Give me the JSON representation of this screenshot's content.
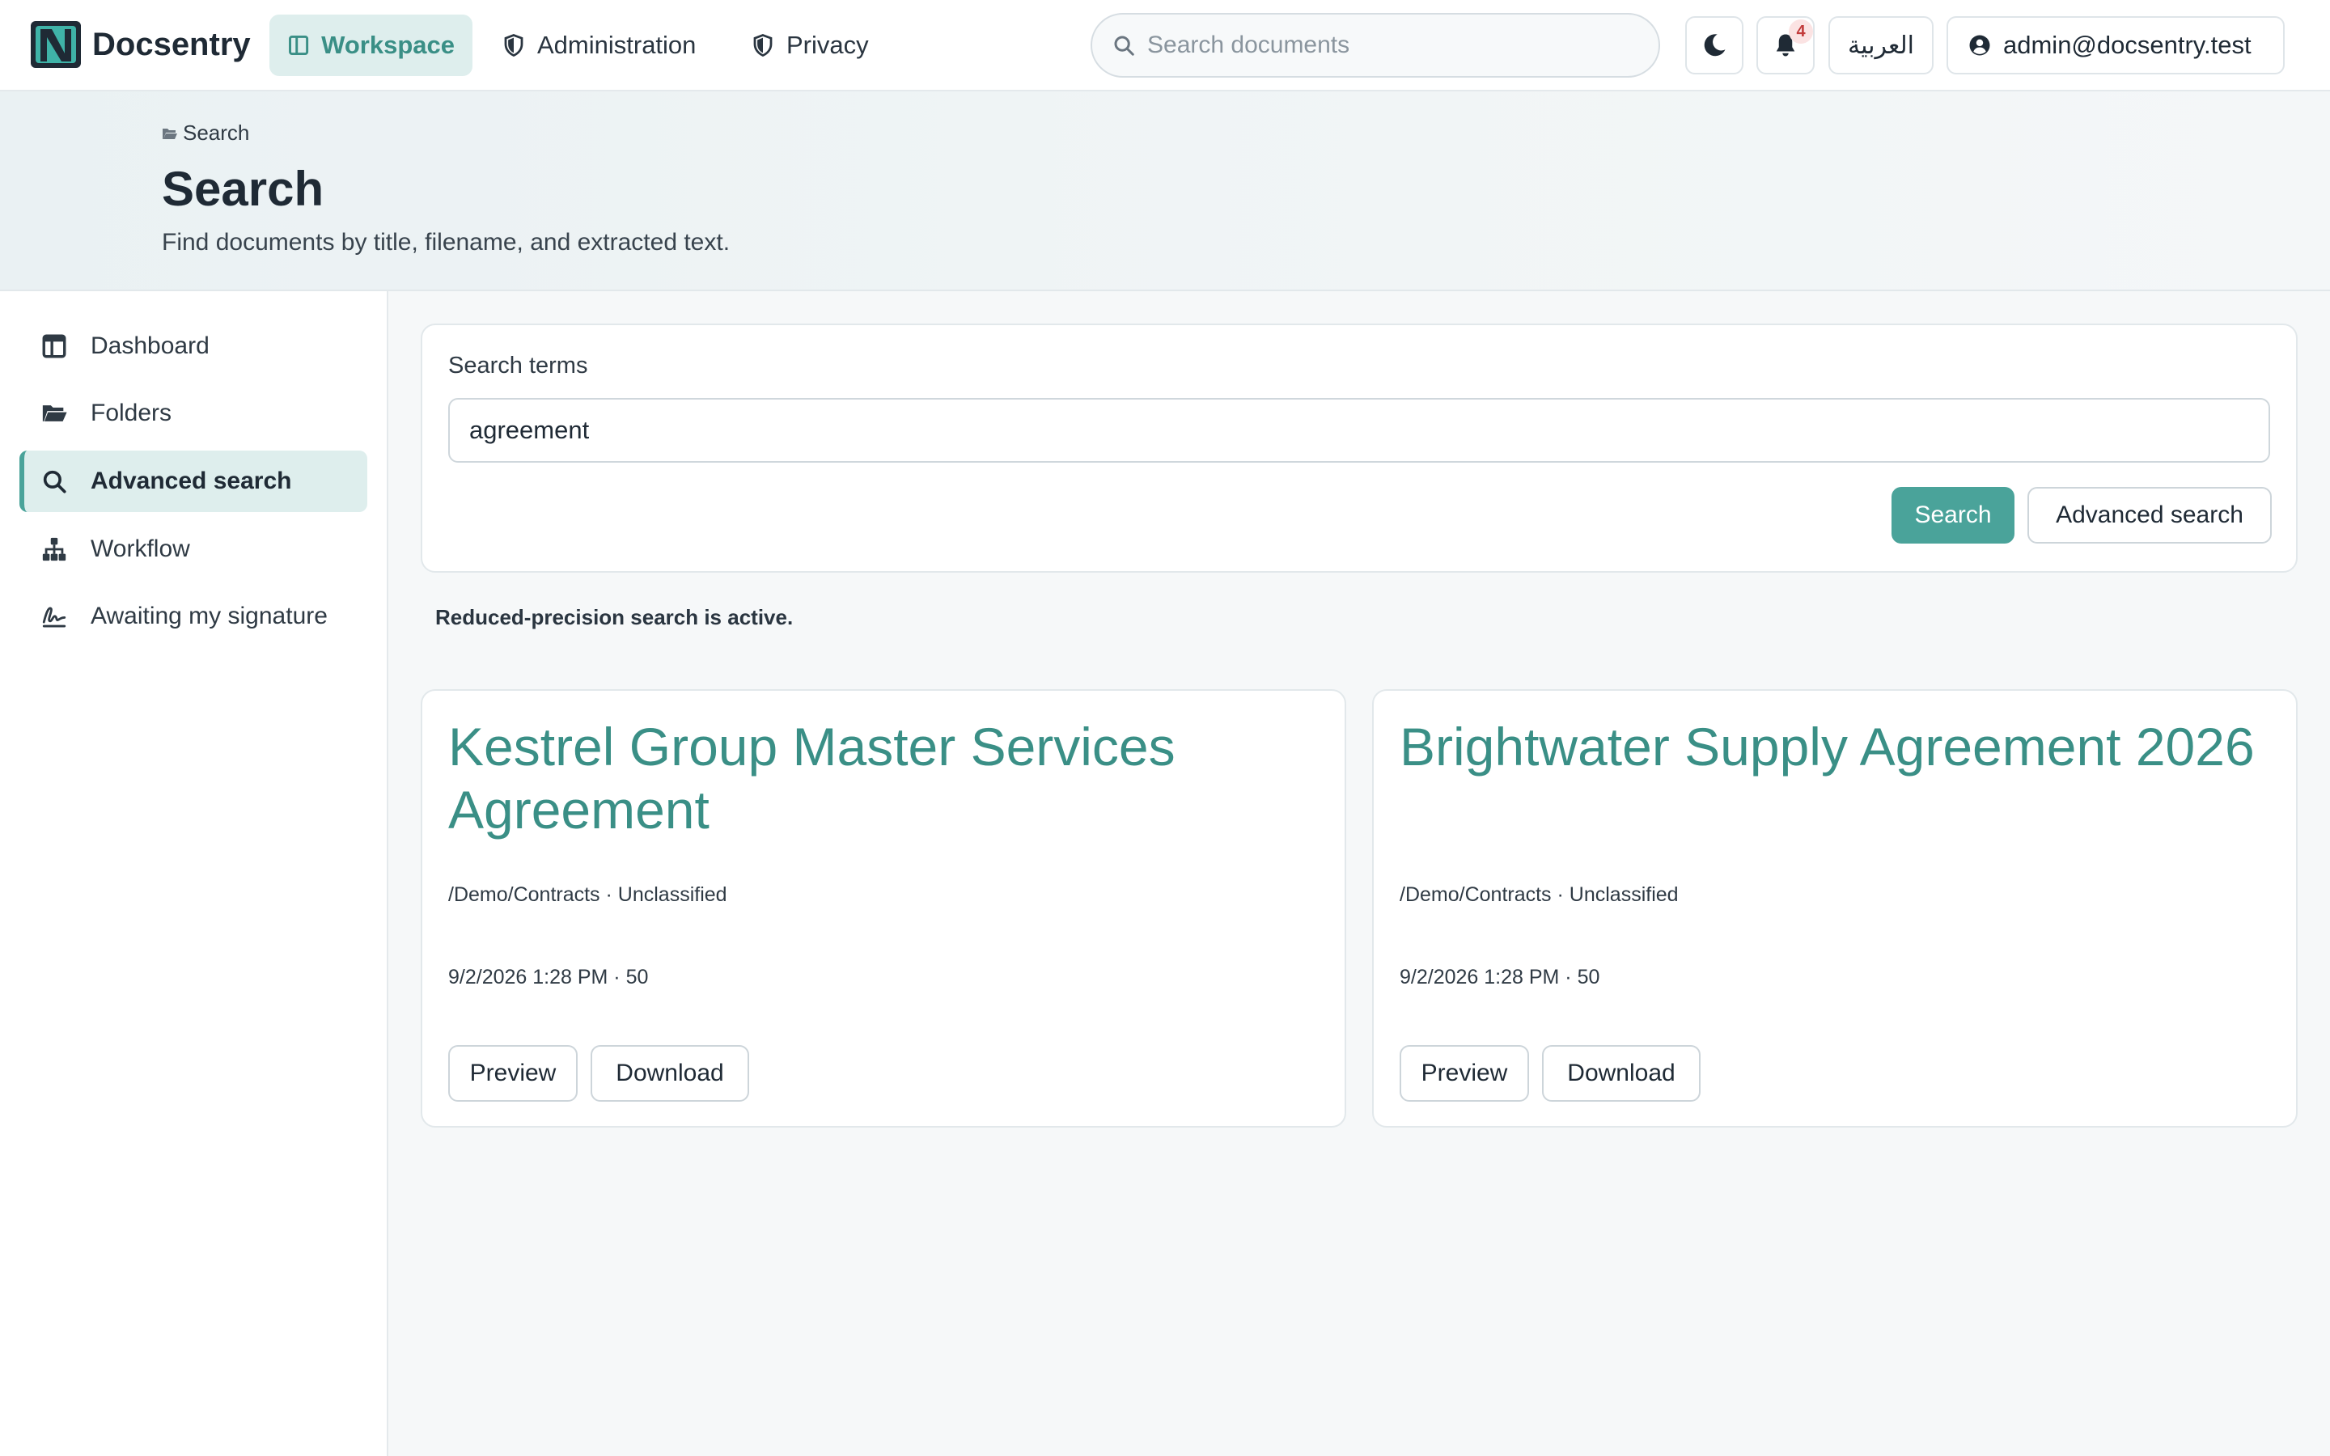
{
  "app": {
    "name": "Docsentry"
  },
  "topnav": {
    "items": [
      {
        "label": "Workspace",
        "icon": "layout-icon",
        "active": true
      },
      {
        "label": "Administration",
        "icon": "shield-icon",
        "active": false
      },
      {
        "label": "Privacy",
        "icon": "shield-icon",
        "active": false
      }
    ],
    "search": {
      "placeholder": "Search documents",
      "value": ""
    },
    "notifications": {
      "count": "4"
    },
    "language": "العربية",
    "user": "admin@docsentry.test"
  },
  "header": {
    "breadcrumb": "Search",
    "title": "Search",
    "subtitle": "Find documents by title, filename, and extracted text."
  },
  "sidebar": {
    "items": [
      {
        "label": "Dashboard",
        "icon": "layout-icon",
        "active": false
      },
      {
        "label": "Folders",
        "icon": "folder-open-icon",
        "active": false
      },
      {
        "label": "Advanced search",
        "icon": "search-icon",
        "active": true
      },
      {
        "label": "Workflow",
        "icon": "hierarchy-icon",
        "active": false
      },
      {
        "label": "Awaiting my signature",
        "icon": "signature-icon",
        "active": false
      }
    ]
  },
  "search_form": {
    "label": "Search terms",
    "value": "agreement",
    "search_button": "Search",
    "advanced_button": "Advanced search"
  },
  "notice": "Reduced-precision search is active.",
  "results": [
    {
      "title": "Kestrel Group Master Services Agreement",
      "meta": "/Demo/Contracts · Unclassified",
      "date": "9/2/2026 1:28 PM · 50",
      "preview": "Preview",
      "download": "Download"
    },
    {
      "title": "Brightwater Supply Agreement 2026",
      "meta": "/Demo/Contracts · Unclassified",
      "date": "9/2/2026 1:28 PM · 50",
      "preview": "Preview",
      "download": "Download"
    }
  ],
  "colors": {
    "accent": "#4aa39a",
    "accent_text": "#3a8f86",
    "active_bg": "#deeeed",
    "badge_text": "#c23b3b"
  }
}
